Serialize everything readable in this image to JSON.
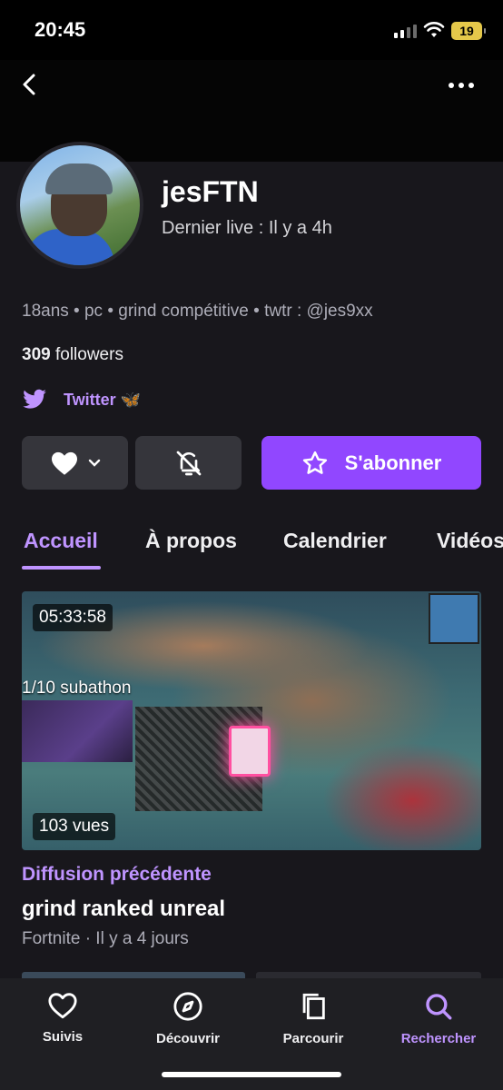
{
  "status_bar": {
    "time": "20:45",
    "battery": "19"
  },
  "profile": {
    "channel_name": "jesFTN",
    "last_live": "Dernier live : Il y a 4h",
    "bio": "18ans • pc • grind compétitive • twtr : @jes9xx",
    "followers_count": "309",
    "followers_label": "followers",
    "social_link": "Twitter 🦋"
  },
  "actions": {
    "subscribe_label": "S'abonner"
  },
  "tabs": [
    {
      "label": "Accueil",
      "active": true
    },
    {
      "label": "À propos",
      "active": false
    },
    {
      "label": "Calendrier",
      "active": false
    },
    {
      "label": "Vidéos",
      "active": false
    }
  ],
  "vod": {
    "duration": "05:33:58",
    "overlay_text": "1/10 subathon",
    "views": "103 vues",
    "category": "Diffusion précédente",
    "title": "grind ranked unreal",
    "meta": "Fortnite · Il y a 4 jours"
  },
  "bottom_nav": [
    {
      "label": "Suivis",
      "icon": "heart-icon"
    },
    {
      "label": "Découvrir",
      "icon": "compass-icon"
    },
    {
      "label": "Parcourir",
      "icon": "browse-icon"
    },
    {
      "label": "Rechercher",
      "icon": "search-icon",
      "active": true
    }
  ],
  "colors": {
    "accent": "#9147ff",
    "accent_text": "#bf94ff",
    "background": "#18171c",
    "twitter": "#bf94ff"
  }
}
